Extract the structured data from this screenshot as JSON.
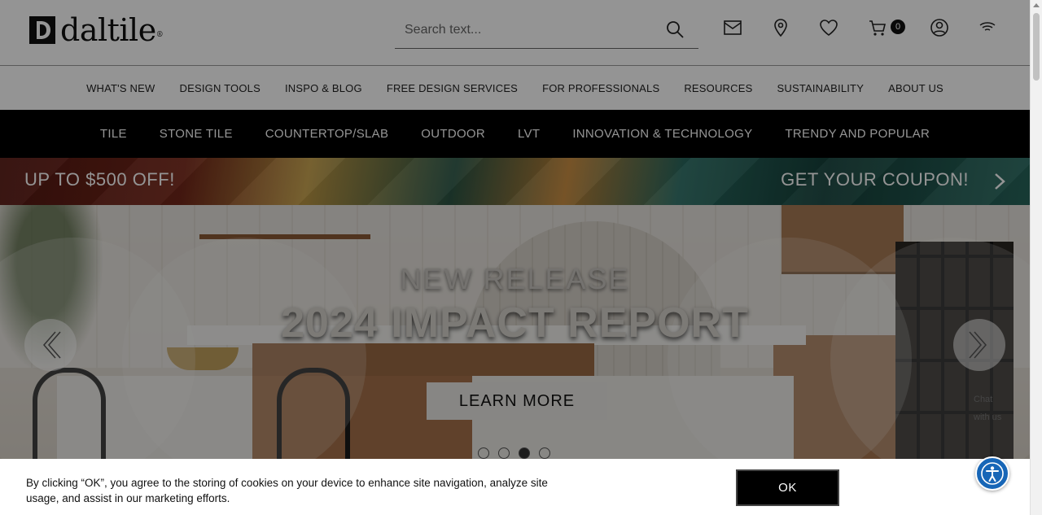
{
  "header": {
    "logo_text": "daltile",
    "logo_reg": "®",
    "search_placeholder": "Search text...",
    "cart_count": "0"
  },
  "nav_primary": [
    "WHAT'S NEW",
    "DESIGN TOOLS",
    "INSPO & BLOG",
    "FREE DESIGN SERVICES",
    "FOR PROFESSIONALS",
    "RESOURCES",
    "SUSTAINABILITY",
    "ABOUT US"
  ],
  "nav_categories": [
    "TILE",
    "STONE TILE",
    "COUNTERTOP/SLAB",
    "OUTDOOR",
    "LVT",
    "INNOVATION & TECHNOLOGY",
    "TRENDY AND POPULAR"
  ],
  "promo": {
    "left_text": "UP TO $500 OFF!",
    "right_text": "GET YOUR COUPON!"
  },
  "hero": {
    "kicker": "NEW RELEASE",
    "title": "2024 IMPACT REPORT",
    "cta_label": "LEARN MORE",
    "slide_count": 4,
    "active_slide": 3,
    "broken_image_alt": "Chat with us"
  },
  "cookie": {
    "text": "By clicking “OK”, you agree to the storing of cookies on your device to enhance site navigation, analyze site usage, and assist in our marketing efforts.",
    "ok_label": "OK"
  },
  "colors": {
    "nav_dark": "#000000",
    "a11y_blue": "#1766b7",
    "cookie_button": "#000000"
  },
  "icons": {
    "search": "search-icon",
    "mail": "mail-icon",
    "location": "location-pin-icon",
    "wishlist": "heart-icon",
    "cart": "cart-icon",
    "account": "user-account-icon",
    "signal": "wifi-icon",
    "accessibility": "accessibility-icon"
  }
}
